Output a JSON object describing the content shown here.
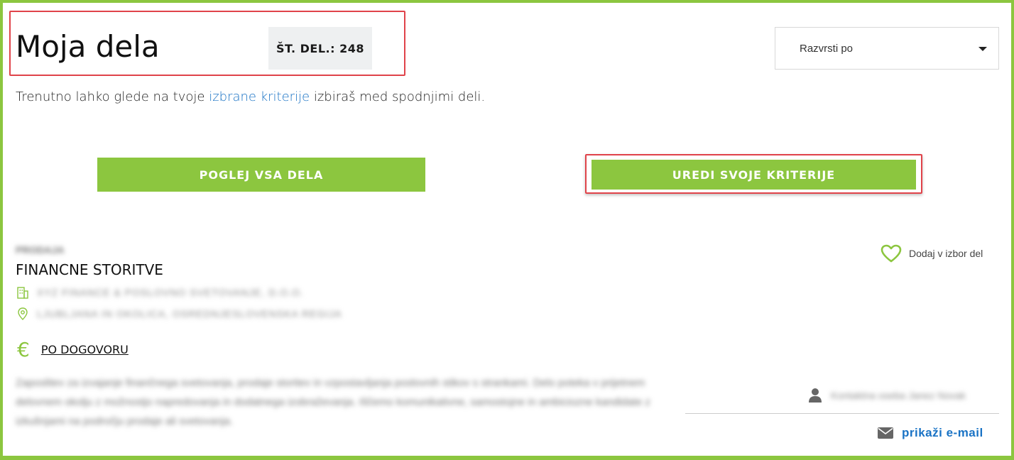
{
  "header": {
    "title": "Moja dela",
    "count_label": "ŠT. DEL.: 248"
  },
  "sort": {
    "placeholder": "Razvrsti po"
  },
  "intro": {
    "before": "Trenutno lahko glede na tvoje ",
    "link": "izbrane kriterije",
    "after": " izbiraš med spodnjimi deli."
  },
  "buttons": {
    "all_jobs": "POGLEJ VSA DELA",
    "edit_criteria": "UREDI SVOJE KRITERIJE"
  },
  "job": {
    "category": "PRODAJA",
    "title": "FINANCNE STORITVE",
    "company": "XYZ FINANCE & POSLOVNO SVETOVANJE, D.O.O.",
    "location": "LJUBLJANA IN OKOLICA, OSREDNJESLOVENSKA REGIJA",
    "salary": "PO DOGOVORU",
    "description": "Zaposlitev za izvajanje finančnega svetovanja, prodaje storitev in vzpostavljanja poslovnih stikov s strankami. Delo poteka v prijetnem delovnem okolju z možnostjo napredovanja in dodatnega izobraževanja. Iščemo komunikativne, samostojne in ambiciozne kandidate z izkušnjami na področju prodaje ali svetovanja.",
    "favorite_label": "Dodaj v izbor del",
    "contact_name": "Kontaktna oseba Janez Novak",
    "email_label": "prikaži e-mail"
  },
  "colors": {
    "accent_green": "#8cc63f",
    "link_blue": "#1a73c5",
    "highlight_red": "#e0434a"
  },
  "icons": {
    "sort": "chevron-down-icon",
    "company": "building-icon",
    "location": "map-pin-icon",
    "salary": "euro-icon",
    "favorite": "heart-icon",
    "contact": "user-icon",
    "email": "envelope-icon"
  }
}
